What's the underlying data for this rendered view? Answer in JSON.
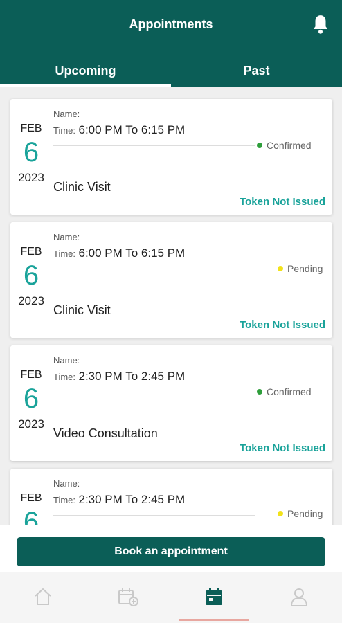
{
  "header": {
    "title": "Appointments",
    "icon": "bell-icon"
  },
  "tabs": [
    {
      "label": "Upcoming",
      "active": true
    },
    {
      "label": "Past",
      "active": false
    }
  ],
  "appointments": [
    {
      "month": "FEB",
      "day": "6",
      "year": "2023",
      "name_label": "Name:",
      "time_label": "Time:",
      "time": "6:00 PM To 6:15 PM",
      "status": "Confirmed",
      "status_color": "#2e9e3b",
      "visit_type": "Clinic Visit",
      "token": "Token Not Issued"
    },
    {
      "month": "FEB",
      "day": "6",
      "year": "2023",
      "name_label": "Name:",
      "time_label": "Time:",
      "time": "6:00 PM To 6:15 PM",
      "status": "Pending",
      "status_color": "#f2e21a",
      "visit_type": "Clinic Visit",
      "token": "Token Not Issued"
    },
    {
      "month": "FEB",
      "day": "6",
      "year": "2023",
      "name_label": "Name:",
      "time_label": "Time:",
      "time": "2:30 PM To 2:45 PM",
      "status": "Confirmed",
      "status_color": "#2e9e3b",
      "visit_type": "Video Consultation",
      "token": "Token Not Issued"
    },
    {
      "month": "FEB",
      "day": "6",
      "year": "2023",
      "name_label": "Name:",
      "time_label": "Time:",
      "time": "2:30 PM To 2:45 PM",
      "status": "Pending",
      "status_color": "#f2e21a",
      "visit_type": "",
      "token": ""
    }
  ],
  "book_button": {
    "label": "Book an appointment"
  },
  "bottom_nav": [
    {
      "icon": "home-icon",
      "active": false
    },
    {
      "icon": "calendar-add-icon",
      "active": false
    },
    {
      "icon": "calendar-icon",
      "active": true
    },
    {
      "icon": "user-icon",
      "active": false
    }
  ],
  "colors": {
    "primary": "#0b5e57",
    "accent": "#1aa39a",
    "confirmed": "#2e9e3b",
    "pending": "#f2e21a",
    "nav_indicator": "#e8a7a0"
  }
}
